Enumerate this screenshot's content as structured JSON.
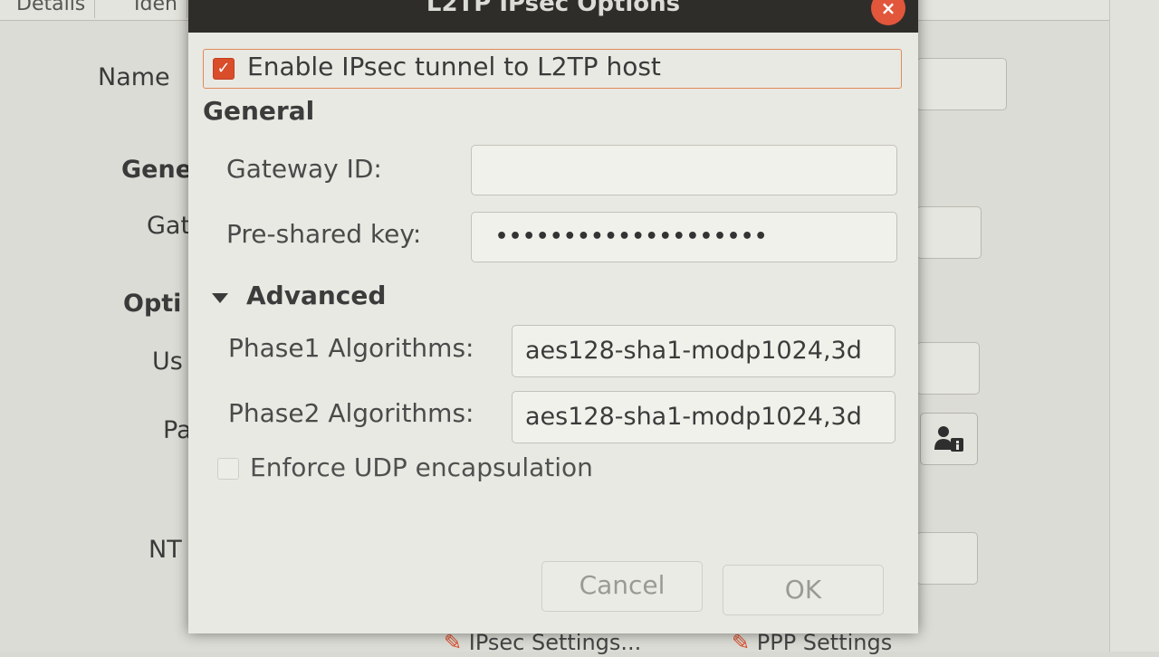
{
  "background": {
    "tabs": [
      "Details",
      "Iden"
    ],
    "labels": {
      "name": "Name",
      "general": "Gene",
      "gateway": "Gat",
      "options": "Opti",
      "user": "Us",
      "password": "Pa",
      "nt": "NT"
    },
    "bottom_buttons": {
      "ipsec_settings": "IPsec Settings...",
      "ppp_settings": "PPP Settings"
    }
  },
  "dialog": {
    "title": "L2TP IPsec Options",
    "close_glyph": "×",
    "enable_label": "Enable IPsec tunnel to L2TP host",
    "enable_checked": true,
    "general_title": "General",
    "gateway_id_label": "Gateway ID:",
    "gateway_id_value": "",
    "psk_label": "Pre-shared key:",
    "psk_value": "••••••••••••••••••••",
    "advanced_title": "Advanced",
    "phase1_label": "Phase1 Algorithms:",
    "phase1_value": "aes128-sha1-modp1024,3d",
    "phase2_label": "Phase2 Algorithms:",
    "phase2_value": "aes128-sha1-modp1024,3d",
    "udp_label": "Enforce UDP encapsulation",
    "udp_checked": false,
    "cancel_label": "Cancel",
    "ok_label": "OK"
  },
  "colors": {
    "accent": "#d94d2a",
    "titlebar": "#2f2d29",
    "close": "#e2563b"
  }
}
